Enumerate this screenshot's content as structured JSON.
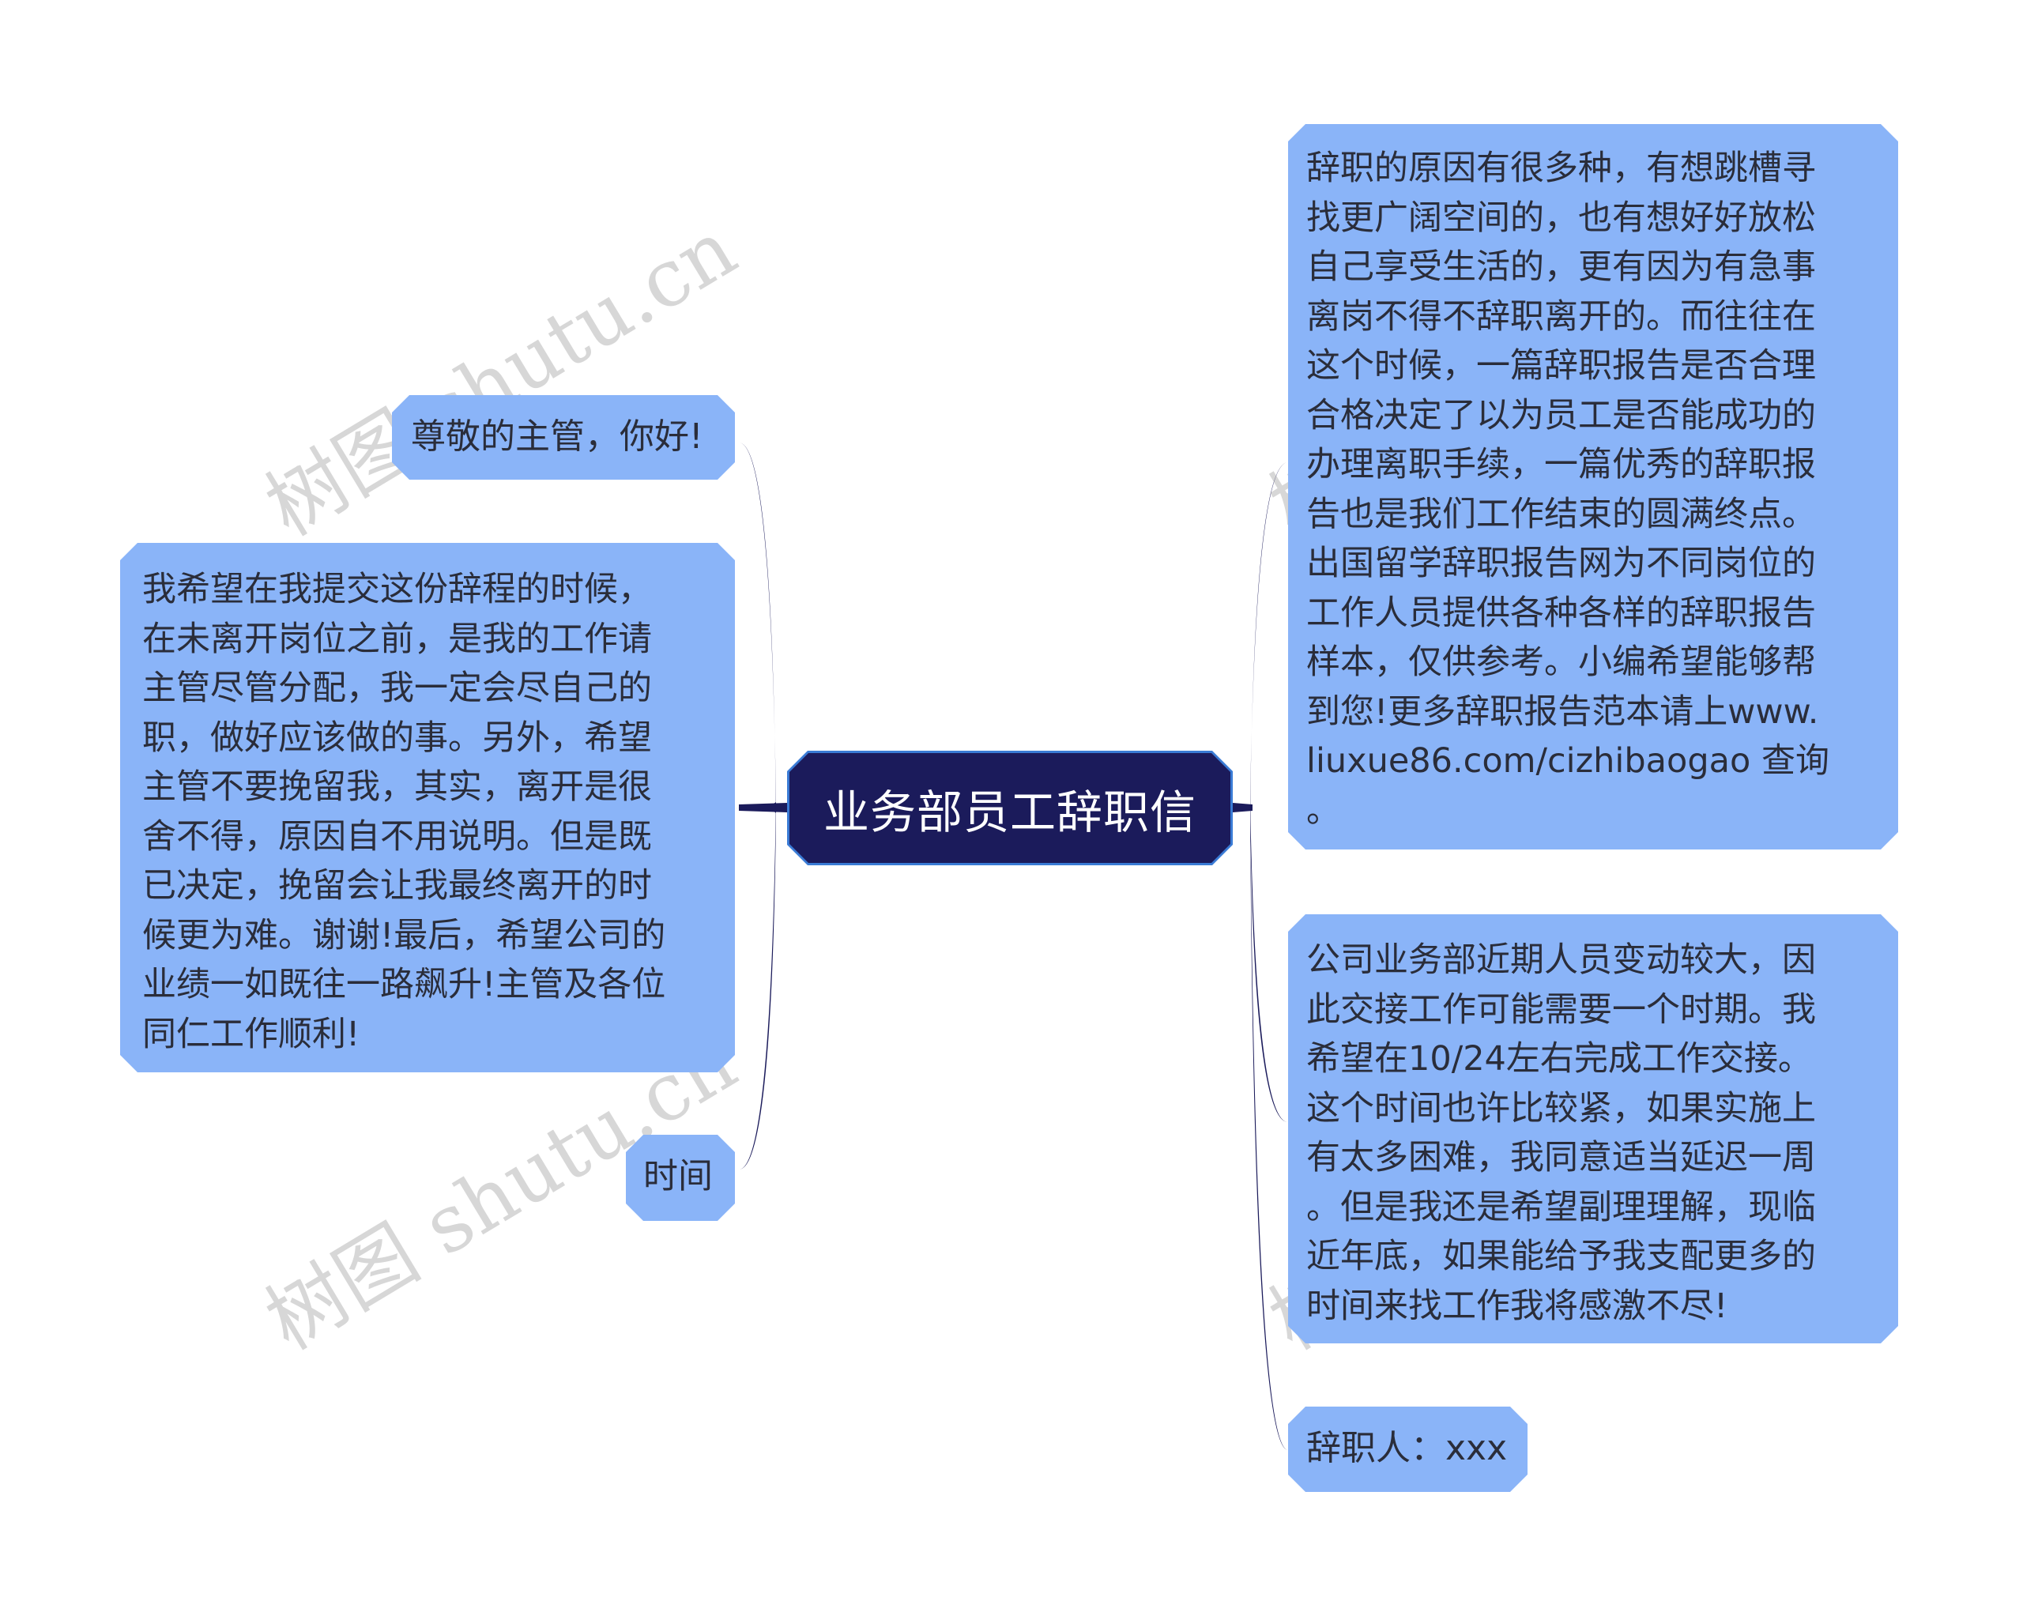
{
  "central": {
    "title": "业务部员工辞职信"
  },
  "colors": {
    "branch": "#1B1B5B",
    "node_fill": "#8AB4F8",
    "central_fill": "#1B1B5B",
    "central_border": "#3A7BD5"
  },
  "left": [
    {
      "id": "greeting",
      "text": "尊敬的主管，你好!"
    },
    {
      "id": "body",
      "text": "我希望在我提交这份辞程的时候，\n在未离开岗位之前，是我的工作请\n主管尽管分配，我一定会尽自己的\n职，做好应该做的事。另外，希望\n主管不要挽留我，其实，离开是很\n舍不得，原因自不用说明。但是既\n已决定，挽留会让我最终离开的时\n候更为难。谢谢!最后，希望公司的\n业绩一如既往一路飙升!主管及各位\n同仁工作顺利!"
    },
    {
      "id": "time",
      "text": "时间"
    }
  ],
  "right": [
    {
      "id": "reasons",
      "text": "辞职的原因有很多种，有想跳槽寻\n找更广阔空间的，也有想好好放松\n自己享受生活的，更有因为有急事\n离岗不得不辞职离开的。而往往在\n这个时候，一篇辞职报告是否合理\n合格决定了以为员工是否能成功的\n办理离职手续，一篇优秀的辞职报\n告也是我们工作结束的圆满终点。\n出国留学辞职报告网为不同岗位的\n工作人员提供各种各样的辞职报告\n样本，仅供参考。小编希望能够帮\n到您!更多辞职报告范本请上www.\nliuxue86.com/cizhibaogao 查询\n。"
    },
    {
      "id": "handover",
      "text": "公司业务部近期人员变动较大，因\n此交接工作可能需要一个时期。我\n希望在10/24左右完成工作交接。\n这个时间也许比较紧，如果实施上\n有太多困难，我同意适当延迟一周\n。但是我还是希望副理理解，现临\n近年底，如果能给予我支配更多的\n时间来找工作我将感激不尽!"
    },
    {
      "id": "signer",
      "text": "辞职人：xxx"
    }
  ],
  "watermark": "树图 shutu.cn"
}
